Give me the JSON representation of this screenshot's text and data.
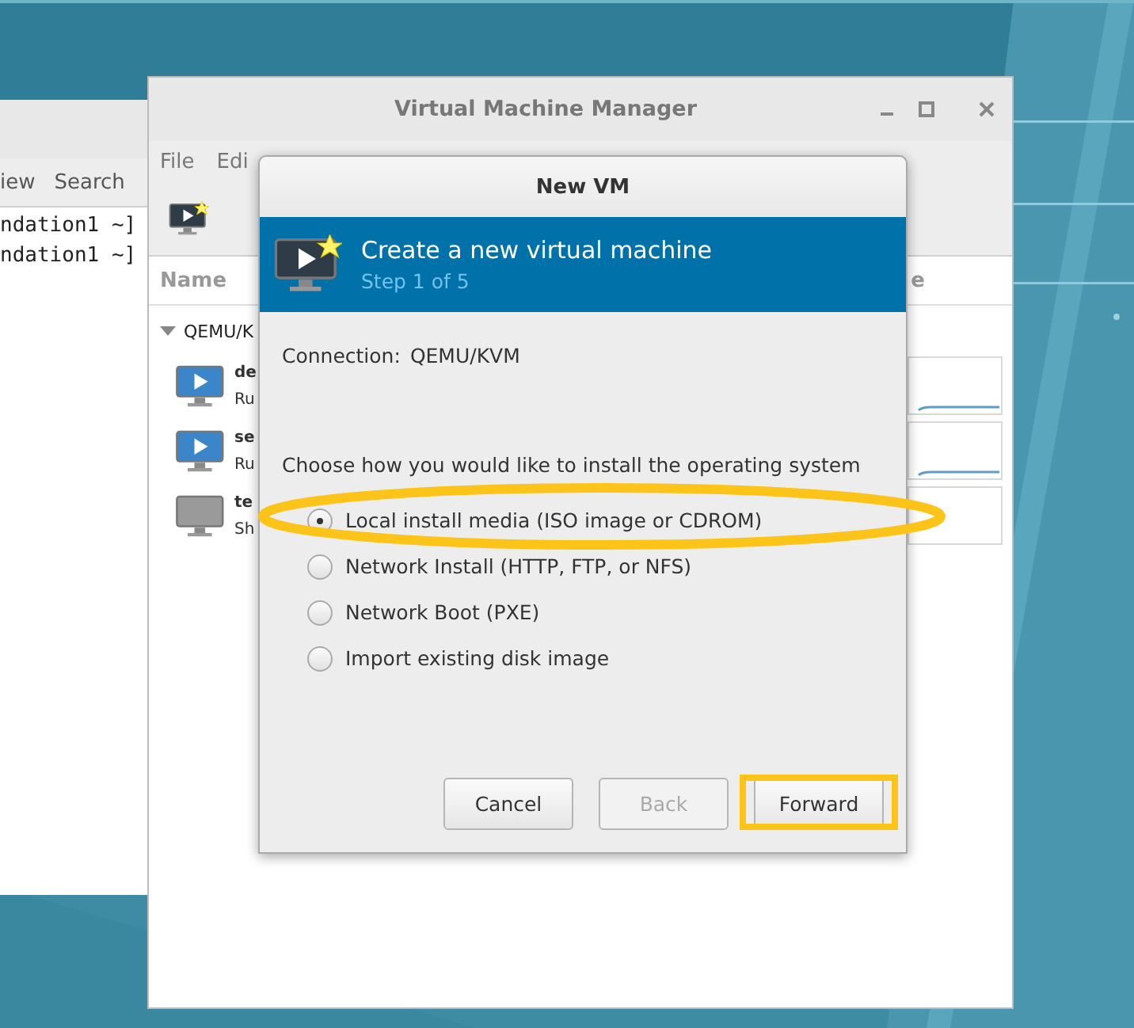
{
  "terminal": {
    "menu": [
      "iew",
      "Search"
    ],
    "lines": [
      "ndation1 ~]",
      "ndation1 ~]"
    ]
  },
  "manager": {
    "title": "Virtual Machine Manager",
    "menu": [
      "File",
      "Edi"
    ],
    "columns": [
      "Name",
      "e"
    ],
    "connection": "QEMU/K",
    "connection_expanded": true,
    "vms": [
      {
        "name": "de",
        "status": "Ru",
        "running": true
      },
      {
        "name": "se",
        "status": "Ru",
        "running": true
      },
      {
        "name": "te",
        "status": "Sh",
        "running": false
      }
    ]
  },
  "dialog": {
    "title": "New VM",
    "heading": "Create a new virtual machine",
    "step": "Step 1 of 5",
    "connection_label": "Connection:",
    "connection": "QEMU/KVM",
    "prompt": "Choose how you would like to install the operating system",
    "options": [
      {
        "label": "Local install media (ISO image or CDROM)",
        "selected": true,
        "highlighted": true
      },
      {
        "label": "Network Install (HTTP, FTP, or NFS)",
        "selected": false,
        "highlighted": false
      },
      {
        "label": "Network Boot (PXE)",
        "selected": false,
        "highlighted": false
      },
      {
        "label": "Import existing disk image",
        "selected": false,
        "highlighted": false
      }
    ],
    "buttons": [
      {
        "label": "Cancel",
        "disabled": false,
        "highlighted": false
      },
      {
        "label": "Back",
        "disabled": true,
        "highlighted": false
      },
      {
        "label": "Forward",
        "disabled": false,
        "highlighted": true
      }
    ]
  }
}
